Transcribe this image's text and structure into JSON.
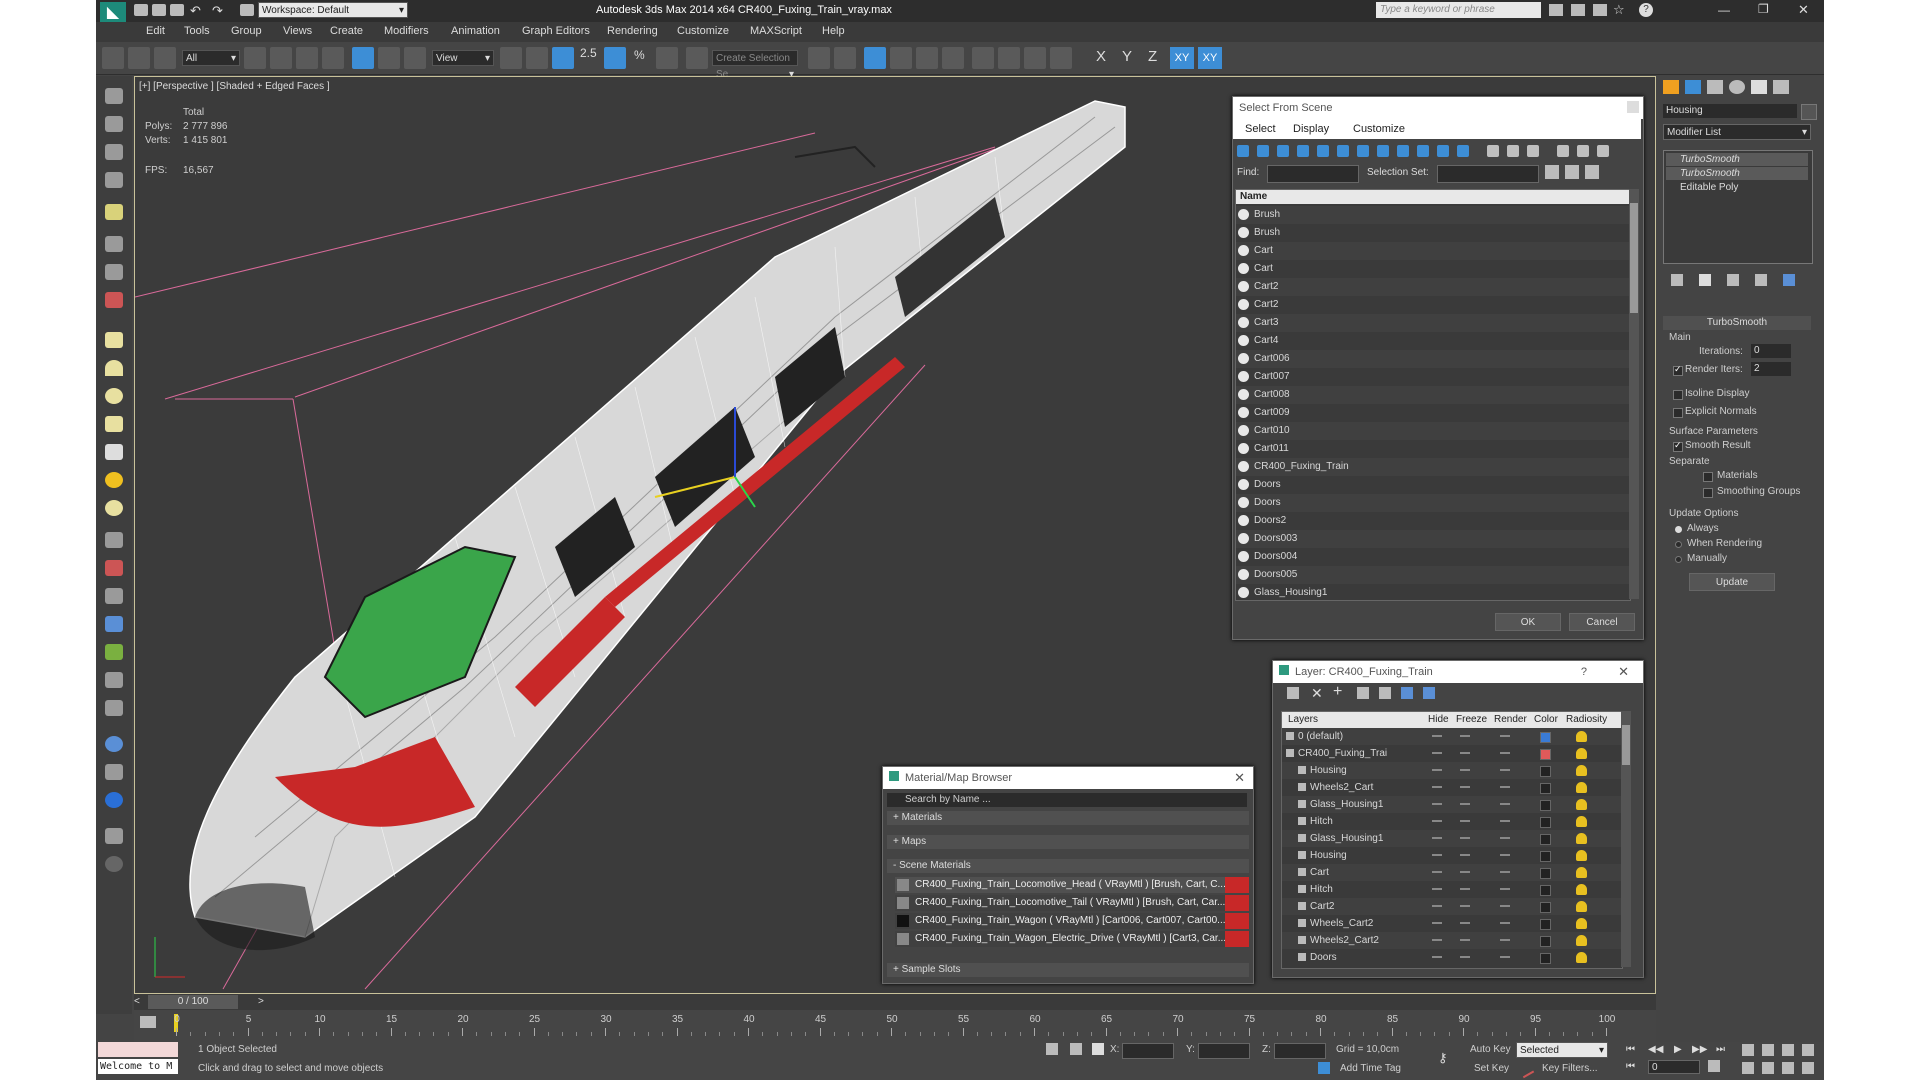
{
  "title_bar": {
    "workspace_label": "Workspace: Default",
    "window_title": "Autodesk 3ds Max  2014 x64     CR400_Fuxing_Train_vray.max",
    "search_placeholder": "Type a keyword or phrase"
  },
  "menu": [
    "Edit",
    "Tools",
    "Group",
    "Views",
    "Create",
    "Modifiers",
    "Animation",
    "Graph Editors",
    "Rendering",
    "Customize",
    "MAXScript",
    "Help"
  ],
  "main_toolbar": {
    "selection_filter": "All",
    "ref_coord": "View",
    "snap_label": "2.5",
    "pct_label": "%",
    "named_sel_placeholder": "Create Selection Se",
    "axis_labels": [
      "X",
      "Y",
      "Z",
      "XY",
      "XY"
    ]
  },
  "viewport": {
    "label": "[+] [Perspective ] [Shaded + Edged Faces ]",
    "stats_header": "Total",
    "polys_label": "Polys:",
    "polys_value": "2 777 896",
    "verts_label": "Verts:",
    "verts_value": "1 415 801",
    "fps_label": "FPS:",
    "fps_value": "16,567"
  },
  "select_from_scene": {
    "title": "Select From Scene",
    "menu": [
      "Select",
      "Display",
      "Customize"
    ],
    "find_label": "Find:",
    "selection_set_label": "Selection Set:",
    "column_name": "Name",
    "objects": [
      "Brush",
      "Brush",
      "Cart",
      "Cart",
      "Cart2",
      "Cart2",
      "Cart3",
      "Cart4",
      "Cart006",
      "Cart007",
      "Cart008",
      "Cart009",
      "Cart010",
      "Cart011",
      "CR400_Fuxing_Train",
      "Doors",
      "Doors",
      "Doors2",
      "Doors003",
      "Doors004",
      "Doors005",
      "Glass_Housing1"
    ],
    "ok_label": "OK",
    "cancel_label": "Cancel"
  },
  "layer_panel": {
    "title": "Layer: CR400_Fuxing_Train",
    "help": "?",
    "columns": [
      "Layers",
      "Hide",
      "Freeze",
      "Render",
      "Color",
      "Radiosity"
    ],
    "rows": [
      "0 (default)",
      "CR400_Fuxing_Trai",
      "Housing",
      "Wheels2_Cart",
      "Glass_Housing1",
      "Hitch",
      "Glass_Housing1",
      "Housing",
      "Cart",
      "Hitch",
      "Cart2",
      "Wheels_Cart2",
      "Wheels2_Cart2",
      "Doors"
    ],
    "row_colors": [
      "#3a7bd5",
      "#e05a5a",
      "#222222",
      "#222222",
      "#222222",
      "#222222",
      "#222222",
      "#222222",
      "#222222",
      "#222222",
      "#222222",
      "#222222",
      "#222222",
      "#222222"
    ]
  },
  "material_browser": {
    "title": "Material/Map Browser",
    "search_placeholder": "Search by Name ...",
    "sections": [
      "+ Materials",
      "+ Maps",
      "- Scene Materials"
    ],
    "materials": [
      "CR400_Fuxing_Train_Locomotive_Head  ( VRayMtl ) [Brush, Cart, C...",
      "CR400_Fuxing_Train_Locomotive_Tail  ( VRayMtl ) [Brush, Cart, Car...",
      "CR400_Fuxing_Train_Wagon  ( VRayMtl ) [Cart006, Cart007, Cart00...",
      "CR400_Fuxing_Train_Wagon_Electric_Drive  ( VRayMtl ) [Cart3, Car..."
    ],
    "sample_slots": "+ Sample Slots"
  },
  "command_panel": {
    "object_name": "Housing",
    "modifier_list": "Modifier List",
    "stack": [
      "TurboSmooth",
      "TurboSmooth",
      "Editable Poly"
    ],
    "rollout_title": "TurboSmooth",
    "main_label": "Main",
    "iterations_label": "Iterations:",
    "iterations_value": "0",
    "render_iters_label": "Render Iters:",
    "render_iters_value": "2",
    "isoline_label": "Isoline Display",
    "explicit_normals_label": "Explicit Normals",
    "surface_params_label": "Surface Parameters",
    "smooth_result_label": "Smooth Result",
    "separate_label": "Separate",
    "materials_label": "Materials",
    "smoothing_groups_label": "Smoothing Groups",
    "update_options_label": "Update Options",
    "always_label": "Always",
    "when_rendering_label": "When Rendering",
    "manually_label": "Manually",
    "update_button": "Update"
  },
  "timeline": {
    "frame_label": "0 / 100",
    "ticks": [
      "0",
      "5",
      "10",
      "15",
      "20",
      "25",
      "30",
      "35",
      "40",
      "45",
      "50",
      "55",
      "60",
      "65",
      "70",
      "75",
      "80",
      "85",
      "90",
      "95",
      "100"
    ]
  },
  "status": {
    "listener": "Welcome to M",
    "selected": "1 Object Selected",
    "prompt": "Click and drag to select and move objects",
    "x_label": "X:",
    "y_label": "Y:",
    "z_label": "Z:",
    "grid": "Grid = 10,0cm",
    "add_time_tag": "Add Time Tag",
    "auto_key": "Auto Key",
    "set_key": "Set Key",
    "selected_dd": "Selected",
    "key_filters": "Key Filters...",
    "frame_value": "0"
  }
}
